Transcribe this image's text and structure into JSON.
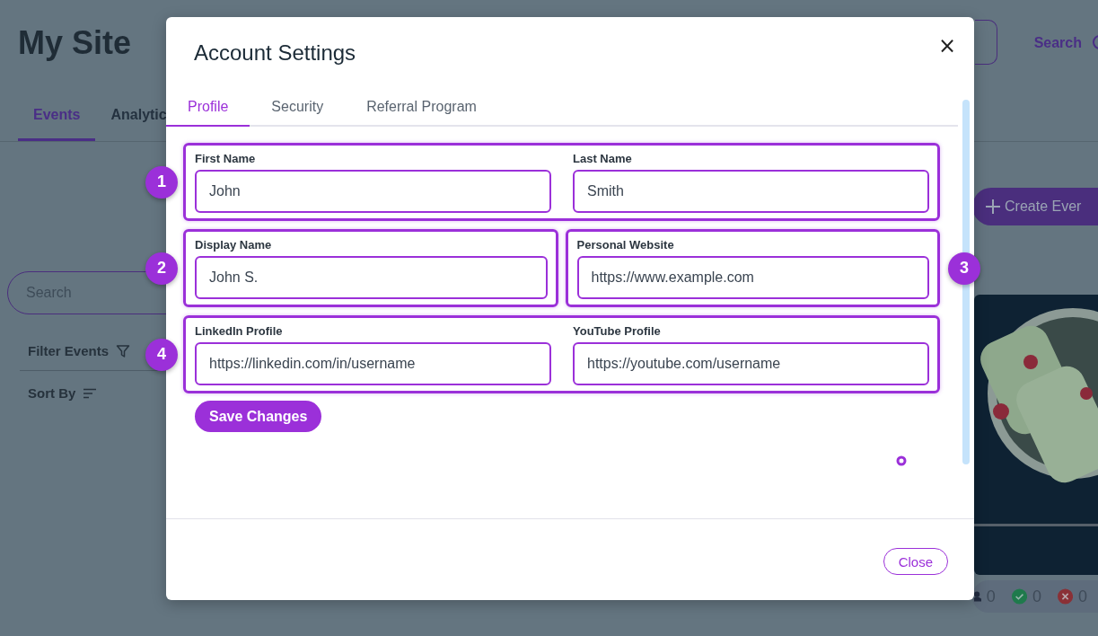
{
  "background": {
    "site_title": "My Site",
    "header_search": "Search",
    "nav_tabs": [
      {
        "label": "Events",
        "selected": true
      },
      {
        "label": "Analytic",
        "selected": false
      }
    ],
    "search_field": {
      "placeholder": "Search"
    },
    "filter_label": "Filter Events",
    "sort_label": "Sort By",
    "create_button": "Create Ever",
    "counters": [
      {
        "kind": "attendees",
        "value": "0"
      },
      {
        "kind": "accepted",
        "value": "0"
      },
      {
        "kind": "declined",
        "value": "0"
      }
    ]
  },
  "modal": {
    "title": "Account Settings",
    "close_icon": "×",
    "tabs": [
      {
        "label": "Profile",
        "selected": true
      },
      {
        "label": "Security",
        "selected": false
      },
      {
        "label": "Referral Program",
        "selected": false
      }
    ],
    "rows": [
      [
        {
          "number": "1",
          "fields": [
            {
              "label": "First Name",
              "value": "John"
            },
            {
              "label": "Last Name",
              "value": "Smith"
            }
          ]
        }
      ],
      [
        {
          "number": "2",
          "fields": [
            {
              "label": "Display Name",
              "value": "John S."
            }
          ]
        },
        {
          "number": "3",
          "fields": [
            {
              "label": "Personal Website",
              "value": "https://www.example.com"
            }
          ]
        }
      ],
      [
        {
          "number": "4",
          "fields": [
            {
              "label": "LinkedIn Profile",
              "value": "https://linkedin.com/in/username"
            },
            {
              "label": "YouTube Profile",
              "value": "https://youtube.com/username"
            }
          ]
        }
      ]
    ],
    "save_button": "Save Changes",
    "close_button": "Close"
  }
}
